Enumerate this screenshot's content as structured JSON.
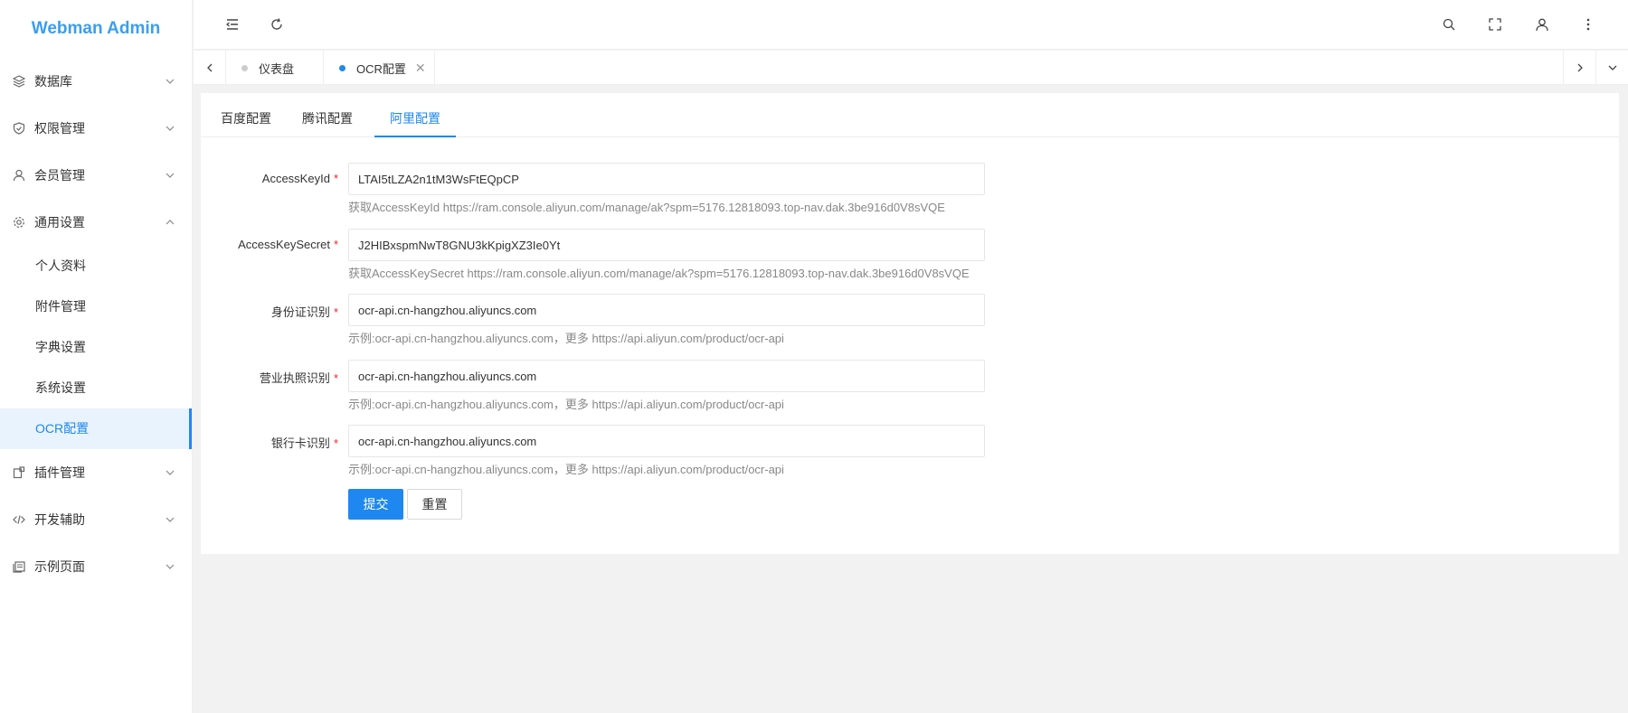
{
  "app": {
    "title": "Webman Admin"
  },
  "sidebar": {
    "items": [
      {
        "label": "数据库",
        "icon": "database-icon"
      },
      {
        "label": "权限管理",
        "icon": "shield-icon"
      },
      {
        "label": "会员管理",
        "icon": "user-icon"
      },
      {
        "label": "通用设置",
        "icon": "gear-icon",
        "expanded": true,
        "children": [
          {
            "label": "个人资料"
          },
          {
            "label": "附件管理"
          },
          {
            "label": "字典设置"
          },
          {
            "label": "系统设置"
          },
          {
            "label": "OCR配置",
            "active": true
          }
        ]
      },
      {
        "label": "插件管理",
        "icon": "plugin-icon"
      },
      {
        "label": "开发辅助",
        "icon": "code-icon"
      },
      {
        "label": "示例页面",
        "icon": "page-icon"
      }
    ]
  },
  "header": {
    "icons": [
      "menu-fold-icon",
      "refresh-icon",
      "search-icon",
      "fullscreen-icon",
      "user-icon",
      "more-icon"
    ]
  },
  "tabs": [
    {
      "label": "仪表盘",
      "active": false
    },
    {
      "label": "OCR配置",
      "active": true,
      "closable": true
    }
  ],
  "config_tabs": [
    {
      "label": "百度配置",
      "active": false
    },
    {
      "label": "腾讯配置",
      "active": false
    },
    {
      "label": "阿里配置",
      "active": true
    }
  ],
  "form": {
    "fields": [
      {
        "label": "AccessKeyId",
        "value": "LTAI5tLZA2n1tM3WsFtEQpCP",
        "help": "获取AccessKeyId https://ram.console.aliyun.com/manage/ak?spm=5176.12818093.top-nav.dak.3be916d0V8sVQE"
      },
      {
        "label": "AccessKeySecret",
        "value": "J2HIBxspmNwT8GNU3kKpigXZ3Ie0Yt",
        "help": "获取AccessKeySecret https://ram.console.aliyun.com/manage/ak?spm=5176.12818093.top-nav.dak.3be916d0V8sVQE"
      },
      {
        "label": "身份证识别",
        "value": "ocr-api.cn-hangzhou.aliyuncs.com",
        "help": "示例:ocr-api.cn-hangzhou.aliyuncs.com，更多 https://api.aliyun.com/product/ocr-api"
      },
      {
        "label": "营业执照识别",
        "value": "ocr-api.cn-hangzhou.aliyuncs.com",
        "help": "示例:ocr-api.cn-hangzhou.aliyuncs.com，更多 https://api.aliyun.com/product/ocr-api"
      },
      {
        "label": "银行卡识别",
        "value": "ocr-api.cn-hangzhou.aliyuncs.com",
        "help": "示例:ocr-api.cn-hangzhou.aliyuncs.com，更多 https://api.aliyun.com/product/ocr-api"
      }
    ],
    "required_mark": "*",
    "submit_label": "提交",
    "reset_label": "重置"
  },
  "colors": {
    "accent": "#1e88f0",
    "logo": "#3a9ef0",
    "required": "#f5222d"
  }
}
